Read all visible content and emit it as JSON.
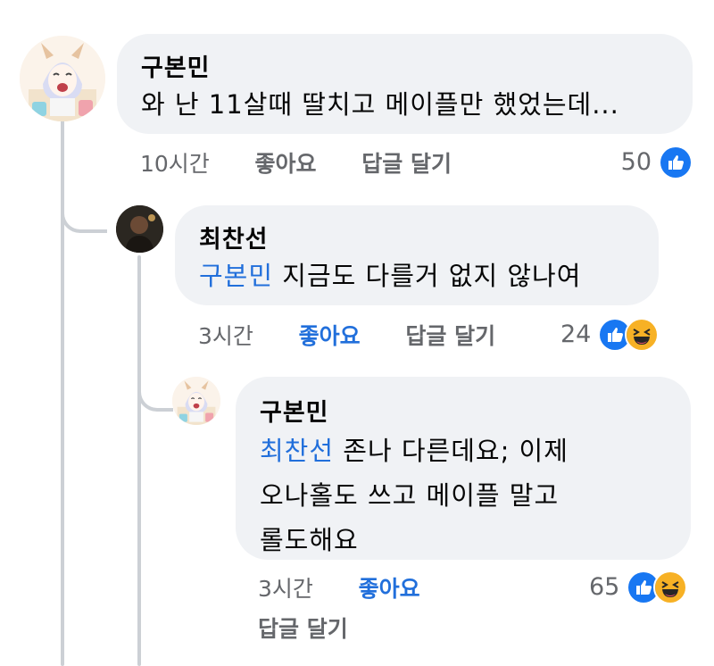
{
  "comments": [
    {
      "author": "구본민",
      "mention": "",
      "lines": [
        "와 난 11살때 딸치고 메이플만 했었는데..."
      ],
      "time": "10시간",
      "like": "좋아요",
      "reply": "답글 달기",
      "reaction_count": "50",
      "reactions": [
        "like-icon"
      ]
    },
    {
      "author": "최찬선",
      "mention": "구본민",
      "lines": [
        "지금도 다를거 없지 않나여"
      ],
      "time": "3시간",
      "like": "좋아요",
      "reply": "답글 달기",
      "reaction_count": "24",
      "reactions": [
        "like-icon",
        "haha-icon"
      ]
    },
    {
      "author": "구본민",
      "mention": "최찬선",
      "lines": [
        "존나 다른데요; 이제",
        "오나홀도 쓰고 메이플 말고",
        "롤도해요"
      ],
      "time": "3시간",
      "like": "좋아요",
      "reply": "답글 달기",
      "reaction_count": "65",
      "reactions": [
        "like-icon",
        "haha-icon"
      ]
    }
  ],
  "colors": {
    "bubble": "#f0f2f5",
    "mention": "#216fdb",
    "meta": "#65676b",
    "like_reaction": "#1877f2",
    "haha_reaction": "#f7b125",
    "thread_line": "#ccd0d5"
  }
}
